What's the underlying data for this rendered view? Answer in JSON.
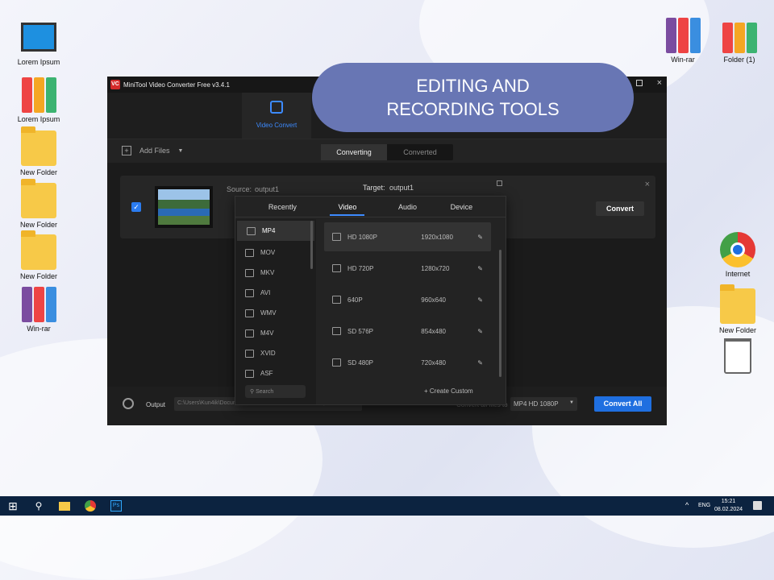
{
  "desktop": {
    "left": [
      "Lorem Ipsum",
      "Lorem Ipsum",
      "New Folder",
      "New Folder",
      "New Folder",
      "Win-rar"
    ],
    "right": [
      "Win-rar",
      "Folder (1)",
      "Internet",
      "New Folder"
    ]
  },
  "banner": {
    "line1": "EDITING AND",
    "line2": "RECORDING TOOLS"
  },
  "app": {
    "title": "MiniTool Video Converter Free v3.4.1",
    "nav_tab": "Video Convert",
    "add_files": "Add Files",
    "seg": [
      "Converting",
      "Converted"
    ],
    "file": {
      "source_label": "Source:",
      "source": "output1",
      "target_label": "Target:",
      "target": "output1",
      "convert": "Convert"
    },
    "popup": {
      "tabs": [
        "Recently",
        "Video",
        "Audio",
        "Device"
      ],
      "formats": [
        "MP4",
        "MOV",
        "MKV",
        "AVI",
        "WMV",
        "M4V",
        "XVID",
        "ASF"
      ],
      "search_placeholder": "Search",
      "resolutions": [
        {
          "name": "HD 1080P",
          "res": "1920x1080"
        },
        {
          "name": "HD 720P",
          "res": "1280x720"
        },
        {
          "name": "640P",
          "res": "960x640"
        },
        {
          "name": "SD 576P",
          "res": "854x480"
        },
        {
          "name": "SD 480P",
          "res": "720x480"
        }
      ],
      "create_custom": "+ Create Custom"
    },
    "bottom": {
      "output_label": "Output",
      "output_path": "C:\\Users\\Kun4ik\\Documents\\MiniTool Video Converter\\Output",
      "convert_all_to": "Convert all files to",
      "format": "MP4 HD 1080P",
      "convert_all": "Convert All"
    }
  },
  "taskbar": {
    "lang": "ENG",
    "time": "15:21",
    "date": "08.02.2024"
  }
}
